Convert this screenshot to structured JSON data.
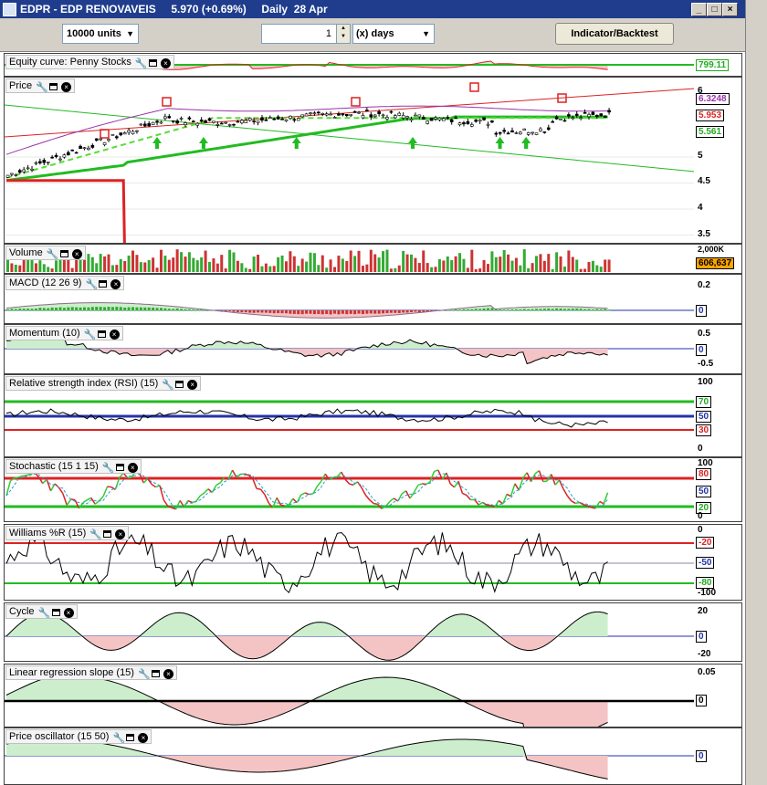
{
  "window": {
    "title": "EDPR - EDP RENOVAVEIS     5.970 (+0.69%)     Daily  28 Apr"
  },
  "toolbar": {
    "units_value": "10000 units",
    "period_value": "1",
    "period_unit": "(x) days",
    "indicator_button": "Indicator/Backtest"
  },
  "icons": {
    "minimize": "minimize-icon",
    "maximize": "maximize-icon",
    "close": "close-icon",
    "wrench": "wrench-icon",
    "window": "window-icon",
    "remove": "close-panel-icon"
  },
  "panels": {
    "equity": {
      "title": "Equity curve: Penny Stocks",
      "badge": "799.11"
    },
    "price": {
      "title": "Price",
      "ticks": [
        "5",
        "4.5",
        "4",
        "3.5"
      ],
      "badges": [
        "6.3248",
        "5.953",
        "5.561"
      ],
      "top_tick": "6"
    },
    "volume": {
      "title": "Volume",
      "badge": "606,637",
      "top_tick": "2,000K"
    },
    "macd": {
      "title": "MACD (12 26 9)",
      "ticks": [
        "0.2"
      ],
      "badge": "0"
    },
    "momentum": {
      "title": "Momentum (10)",
      "ticks": [
        "0.5",
        "-0.5"
      ],
      "badge": "0"
    },
    "rsi": {
      "title": "Relative strength index (RSI) (15)",
      "ticks": [
        "100",
        "0"
      ],
      "badges": [
        "70",
        "50",
        "30"
      ]
    },
    "stochastic": {
      "title": "Stochastic (15 1 15)",
      "ticks": [
        "100",
        "0"
      ],
      "badges": [
        "80",
        "50",
        "20"
      ]
    },
    "williams": {
      "title": "Williams %R (15)",
      "ticks": [
        "0",
        "-100"
      ],
      "badges": [
        "-20",
        "-50",
        "-80"
      ]
    },
    "cycle": {
      "title": "Cycle",
      "ticks": [
        "20",
        "-20"
      ],
      "badge": "0"
    },
    "linreg": {
      "title": "Linear regression slope (15)",
      "ticks": [
        "0.05"
      ],
      "badge": "0"
    },
    "priceosc": {
      "title": "Price oscillator (15 50)",
      "badge": "0"
    }
  },
  "colors": {
    "up": "#ffffff",
    "down": "#000000",
    "green": "#22bb22",
    "red": "#dd2222",
    "purple": "#9933aa",
    "blue": "#2233aa",
    "posfill": "#cceecc",
    "negfill": "#f4c4c4"
  }
}
